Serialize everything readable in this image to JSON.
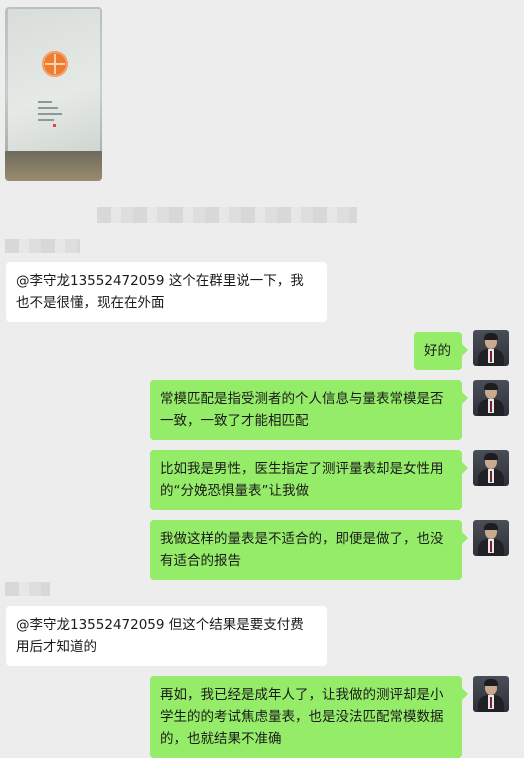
{
  "messages": [
    {
      "text": "@李守龙13552472059 这个在群里说一下，我也不是很懂，现在在外面"
    },
    {
      "text": "好的"
    },
    {
      "text": "常模匹配是指受测者的个人信息与量表常模是否一致，一致了才能相匹配"
    },
    {
      "text": "比如我是男性，医生指定了测评量表却是女性用的“分娩恐惧量表”让我做"
    },
    {
      "text": "我做这样的量表是不适合的，即便是做了，也没有适合的报告"
    },
    {
      "text": "@李守龙13552472059 但这个结果是要支付费用后才知道的"
    },
    {
      "text": "再如，我已经是成年人了，让我做的测评却是小学生的的考试焦虑量表，也是没法匹配常模数据的，也就结果不准确"
    }
  ],
  "icons": {
    "avatar": "user-avatar-icon",
    "photo": "image-thumbnail"
  }
}
